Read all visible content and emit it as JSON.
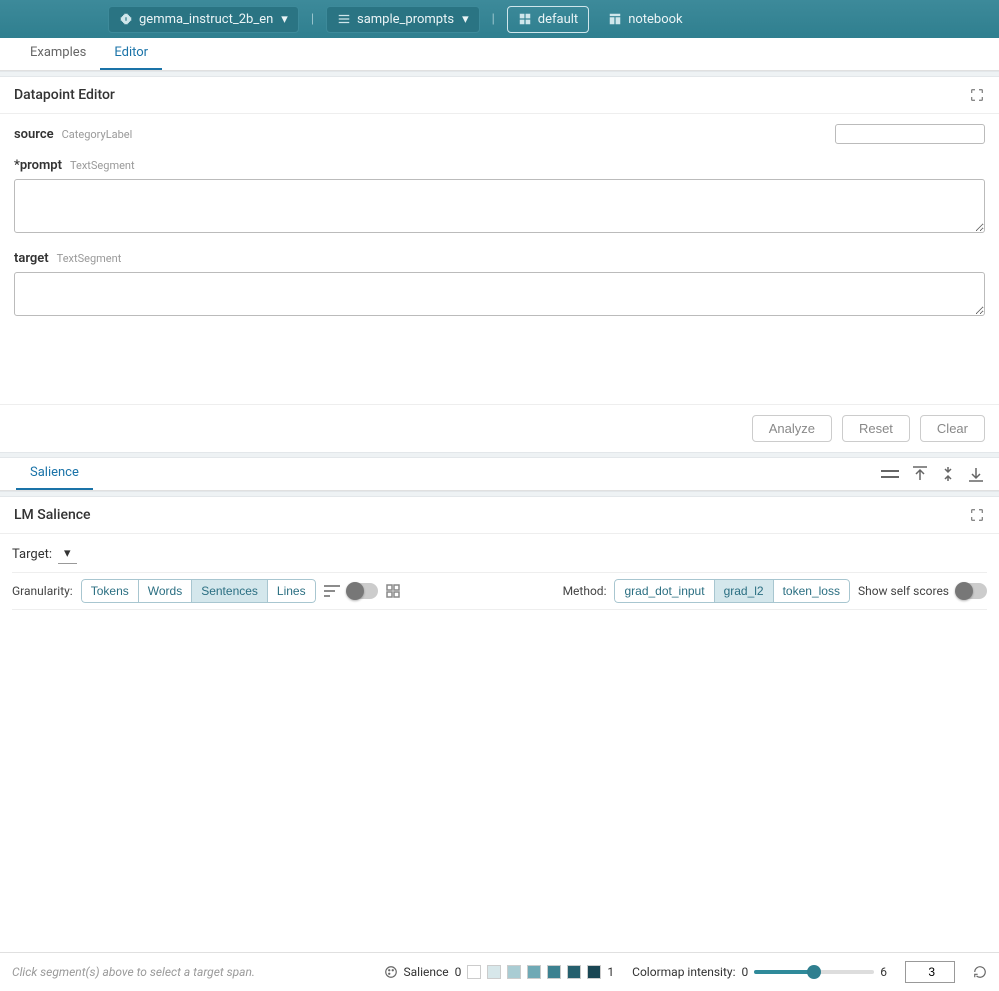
{
  "topbar": {
    "model": "gemma_instruct_2b_en",
    "dataset": "sample_prompts",
    "layout_default": "default",
    "layout_notebook": "notebook"
  },
  "tabs": {
    "examples": "Examples",
    "editor": "Editor"
  },
  "editor": {
    "title": "Datapoint Editor",
    "fields": {
      "source": {
        "label": "source",
        "type": "CategoryLabel",
        "value": ""
      },
      "prompt": {
        "label": "*prompt",
        "type": "TextSegment",
        "value": ""
      },
      "target": {
        "label": "target",
        "type": "TextSegment",
        "value": ""
      }
    },
    "buttons": {
      "analyze": "Analyze",
      "reset": "Reset",
      "clear": "Clear"
    }
  },
  "salience_tab": "Salience",
  "lm_salience": {
    "title": "LM Salience",
    "target_label": "Target:",
    "granularity_label": "Granularity:",
    "granularity_options": [
      "Tokens",
      "Words",
      "Sentences",
      "Lines"
    ],
    "granularity_selected": "Sentences",
    "method_label": "Method:",
    "method_options": [
      "grad_dot_input",
      "grad_l2",
      "token_loss"
    ],
    "method_selected": "grad_l2",
    "self_scores_label": "Show self scores"
  },
  "footer": {
    "hint": "Click segment(s) above to select a target span.",
    "salience_label": "Salience",
    "legend_min": "0",
    "legend_max": "1",
    "colormap_label": "Colormap intensity:",
    "colormap_min": "0",
    "colormap_max": "6",
    "colormap_value": 3,
    "number_value": "3"
  },
  "colors": {
    "swatches": [
      "#ffffff",
      "#d7e7ea",
      "#a9ccd3",
      "#6fa9b5",
      "#3c8190",
      "#255f6d",
      "#194653"
    ]
  }
}
